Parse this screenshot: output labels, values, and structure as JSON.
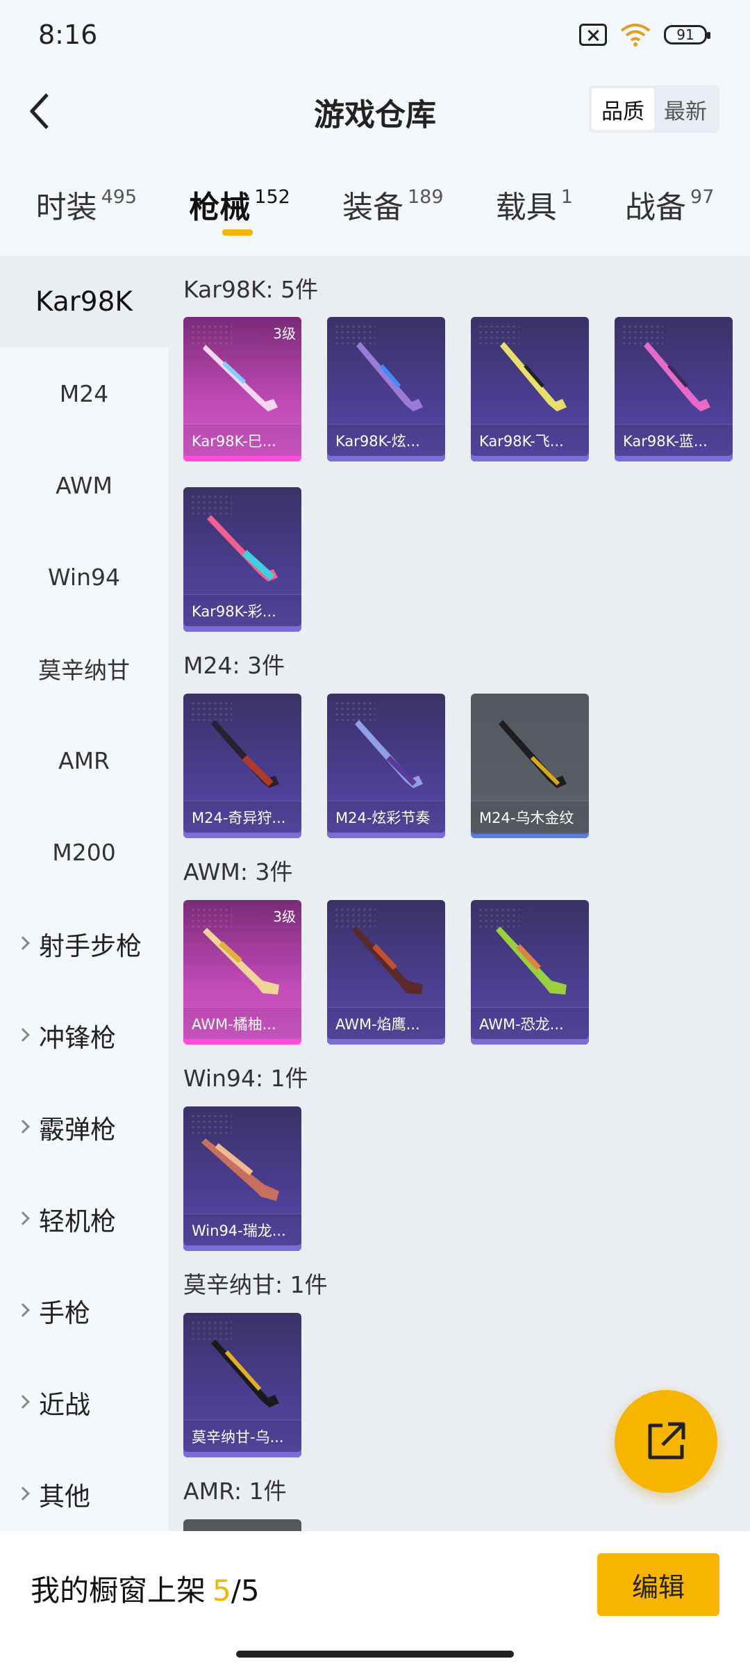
{
  "status_bar": {
    "time": "8:16",
    "battery": "91",
    "network": "6"
  },
  "header": {
    "title": "游戏仓库",
    "sort_options": [
      "品质",
      "最新"
    ],
    "active_sort": "品质"
  },
  "tabs": [
    {
      "label": "时装",
      "count": "495"
    },
    {
      "label": "枪械",
      "count": "152",
      "active": true
    },
    {
      "label": "装备",
      "count": "189"
    },
    {
      "label": "载具",
      "count": "1"
    },
    {
      "label": "战备",
      "count": "97"
    }
  ],
  "sidebar": {
    "items": [
      "Kar98K",
      "M24",
      "AWM",
      "Win94",
      "莫辛纳甘",
      "AMR",
      "M200"
    ],
    "groups": [
      "射手步枪",
      "冲锋枪",
      "霰弹枪",
      "轻机枪",
      "手枪",
      "近战",
      "其他"
    ],
    "active": "Kar98K"
  },
  "categories": [
    {
      "title": "Kar98K: 5件",
      "items": [
        {
          "name": "Kar98K-巳...",
          "level": "3级",
          "style": "pink"
        },
        {
          "name": "Kar98K-炫...",
          "style": "purple"
        },
        {
          "name": "Kar98K-飞...",
          "style": "purple"
        },
        {
          "name": "Kar98K-蓝...",
          "style": "purple"
        },
        {
          "name": "Kar98K-彩...",
          "style": "purple"
        }
      ]
    },
    {
      "title": "M24: 3件",
      "items": [
        {
          "name": "M24-奇异狩...",
          "style": "purple"
        },
        {
          "name": "M24-炫彩节奏",
          "style": "purple"
        },
        {
          "name": "M24-乌木金纹",
          "style": "gray"
        }
      ]
    },
    {
      "title": "AWM: 3件",
      "items": [
        {
          "name": "AWM-橘柚...",
          "level": "3级",
          "style": "pink"
        },
        {
          "name": "AWM-焰鹰...",
          "style": "purple"
        },
        {
          "name": "AWM-恐龙...",
          "style": "purple"
        }
      ]
    },
    {
      "title": "Win94: 1件",
      "items": [
        {
          "name": "Win94-瑞龙...",
          "style": "purple"
        }
      ]
    },
    {
      "title": "莫辛纳甘: 1件",
      "items": [
        {
          "name": "莫辛纳甘-乌...",
          "style": "purple"
        }
      ]
    },
    {
      "title": "AMR: 1件",
      "items": []
    }
  ],
  "bottom_bar": {
    "label": "我的橱窗上架",
    "used": "5",
    "separator": "/",
    "total": "5",
    "edit_button": "编辑"
  },
  "colors": {
    "accent": "#f7b500",
    "epic": "#5a4aa8",
    "legendary": "#d95bcf",
    "common": "#5d6068"
  }
}
